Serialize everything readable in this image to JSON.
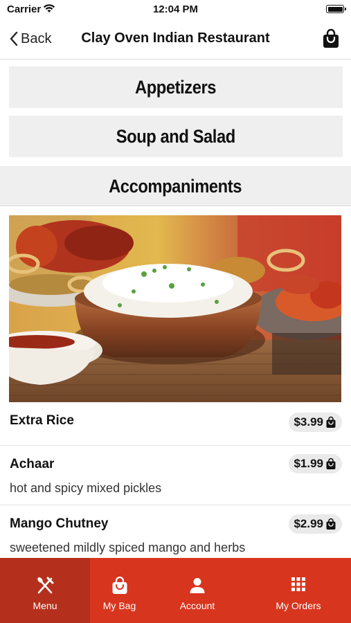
{
  "status_bar": {
    "carrier": "Carrier",
    "time": "12:04 PM"
  },
  "nav": {
    "back_label": "Back",
    "title": "Clay Oven Indian Restaurant"
  },
  "categories": [
    {
      "label": "Appetizers"
    },
    {
      "label": "Soup and Salad"
    },
    {
      "label": "Accompaniments"
    }
  ],
  "hero_image": {
    "alt": "rice-tandoori-dish-photo"
  },
  "items": [
    {
      "name": "Extra Rice",
      "description": "",
      "price": "$3.99"
    },
    {
      "name": "Achaar",
      "description": "hot and spicy mixed pickles",
      "price": "$1.99"
    },
    {
      "name": "Mango Chutney",
      "description": "sweetened mildly spiced mango and herbs",
      "price": "$2.99"
    }
  ],
  "tabs": [
    {
      "label": "Menu",
      "icon": "utensils-icon",
      "active": true
    },
    {
      "label": "My Bag",
      "icon": "bag-icon",
      "active": false
    },
    {
      "label": "Account",
      "icon": "user-icon",
      "active": false
    },
    {
      "label": "My Orders",
      "icon": "grid-icon",
      "active": false
    }
  ],
  "colors": {
    "accent": "#d8351e",
    "accent_active": "#b5301c",
    "category_bg": "#efefef",
    "pill_bg": "#eaeaea"
  }
}
